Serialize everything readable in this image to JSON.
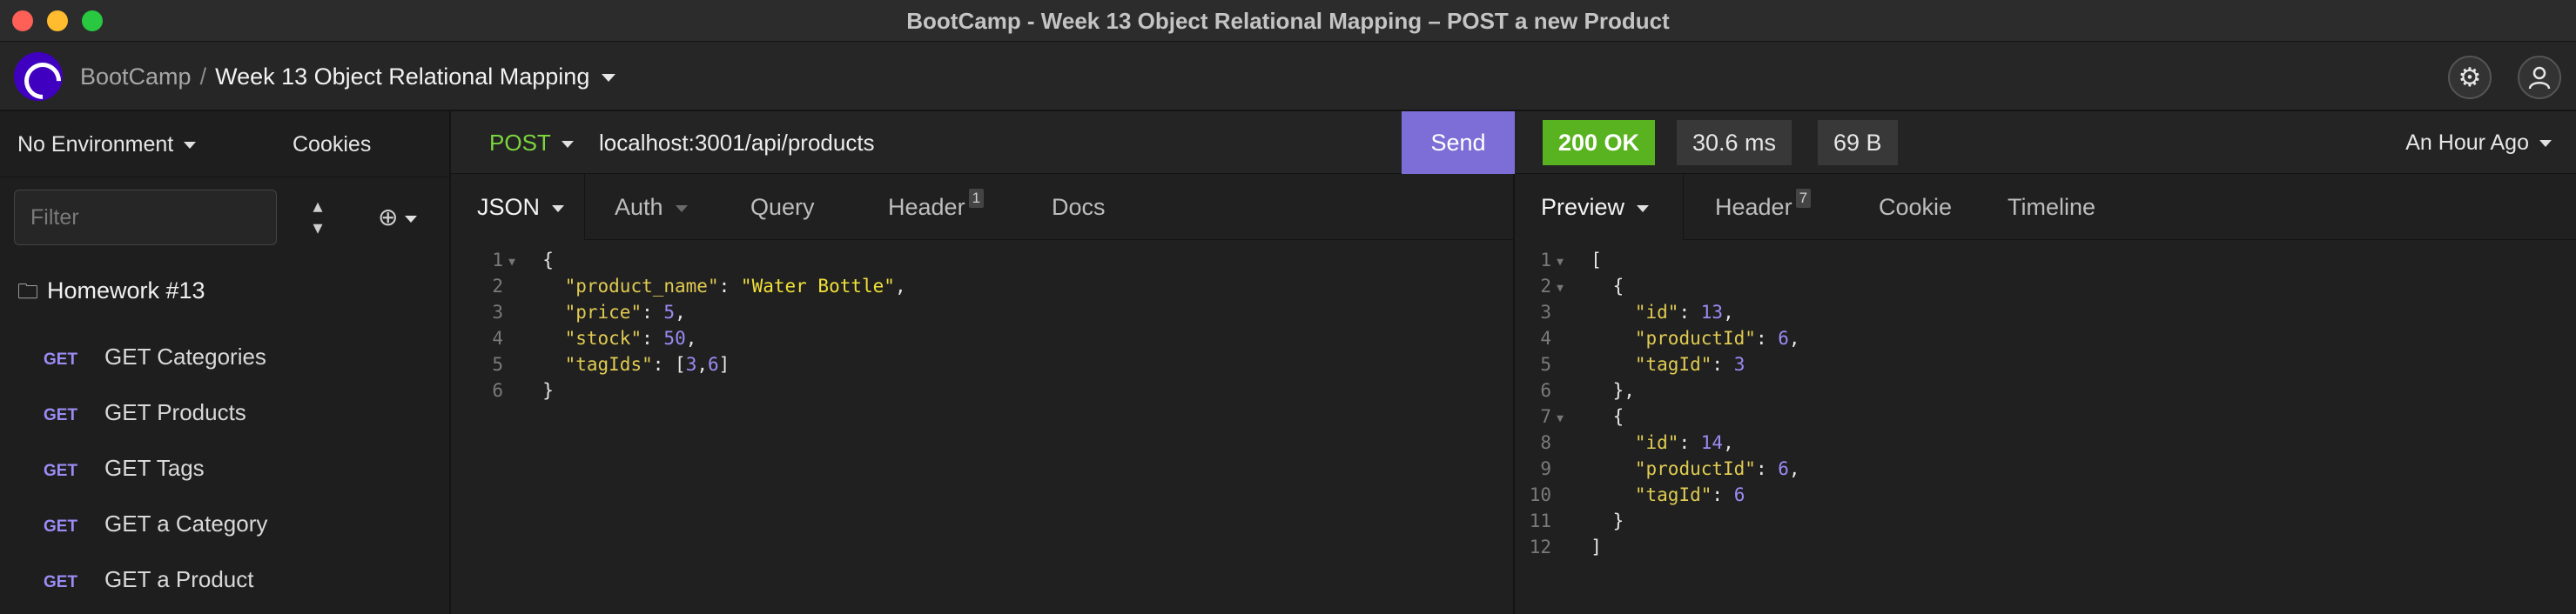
{
  "window": {
    "title": "BootCamp - Week 13 Object Relational Mapping – POST a new Product"
  },
  "appbar": {
    "breadcrumb_root": "BootCamp",
    "breadcrumb_separator": "/",
    "breadcrumb_current": "Week 13 Object Relational Mapping"
  },
  "sidebar": {
    "environment": "No Environment",
    "cookies": "Cookies",
    "filter_placeholder": "Filter",
    "folder": "Homework #13",
    "requests": [
      {
        "method": "GET",
        "name": "GET Categories"
      },
      {
        "method": "GET",
        "name": "GET Products"
      },
      {
        "method": "GET",
        "name": "GET Tags"
      },
      {
        "method": "GET",
        "name": "GET a Category"
      },
      {
        "method": "GET",
        "name": "GET a Product"
      }
    ]
  },
  "request": {
    "method": "POST",
    "url": "localhost:3001/api/products",
    "send_label": "Send",
    "tabs": {
      "body": "JSON",
      "auth": "Auth",
      "query": "Query",
      "header": "Header",
      "header_count": "1",
      "docs": "Docs"
    },
    "body_lines": [
      "{",
      "  \"product_name\": \"Water Bottle\",",
      "  \"price\": 5,",
      "  \"stock\": 50,",
      "  \"tagIds\": [3,6]",
      "}"
    ]
  },
  "response": {
    "status": "200 OK",
    "time": "30.6 ms",
    "size": "69 B",
    "history": "An Hour Ago",
    "tabs": {
      "preview": "Preview",
      "header": "Header",
      "header_count": "7",
      "cookie": "Cookie",
      "timeline": "Timeline"
    },
    "body_lines": [
      "[",
      "  {",
      "    \"id\": 13,",
      "    \"productId\": 6,",
      "    \"tagId\": 3",
      "  },",
      "  {",
      "    \"id\": 14,",
      "    \"productId\": 6,",
      "    \"tagId\": 6",
      "  }",
      "]"
    ]
  },
  "colors": {
    "accent_send": "#7c6ed6",
    "status_ok": "#59b320",
    "method_post": "#7cd43e",
    "method_get": "#9b8cf5",
    "json_key": "#e0cb52",
    "json_number": "#9b8cf5"
  },
  "icons": [
    "close-dot",
    "minimize-dot",
    "maximize-dot",
    "app-logo-icon",
    "gear-icon",
    "user-icon",
    "folder-icon",
    "sort-icon",
    "add-icon",
    "chevron-down-icon"
  ]
}
